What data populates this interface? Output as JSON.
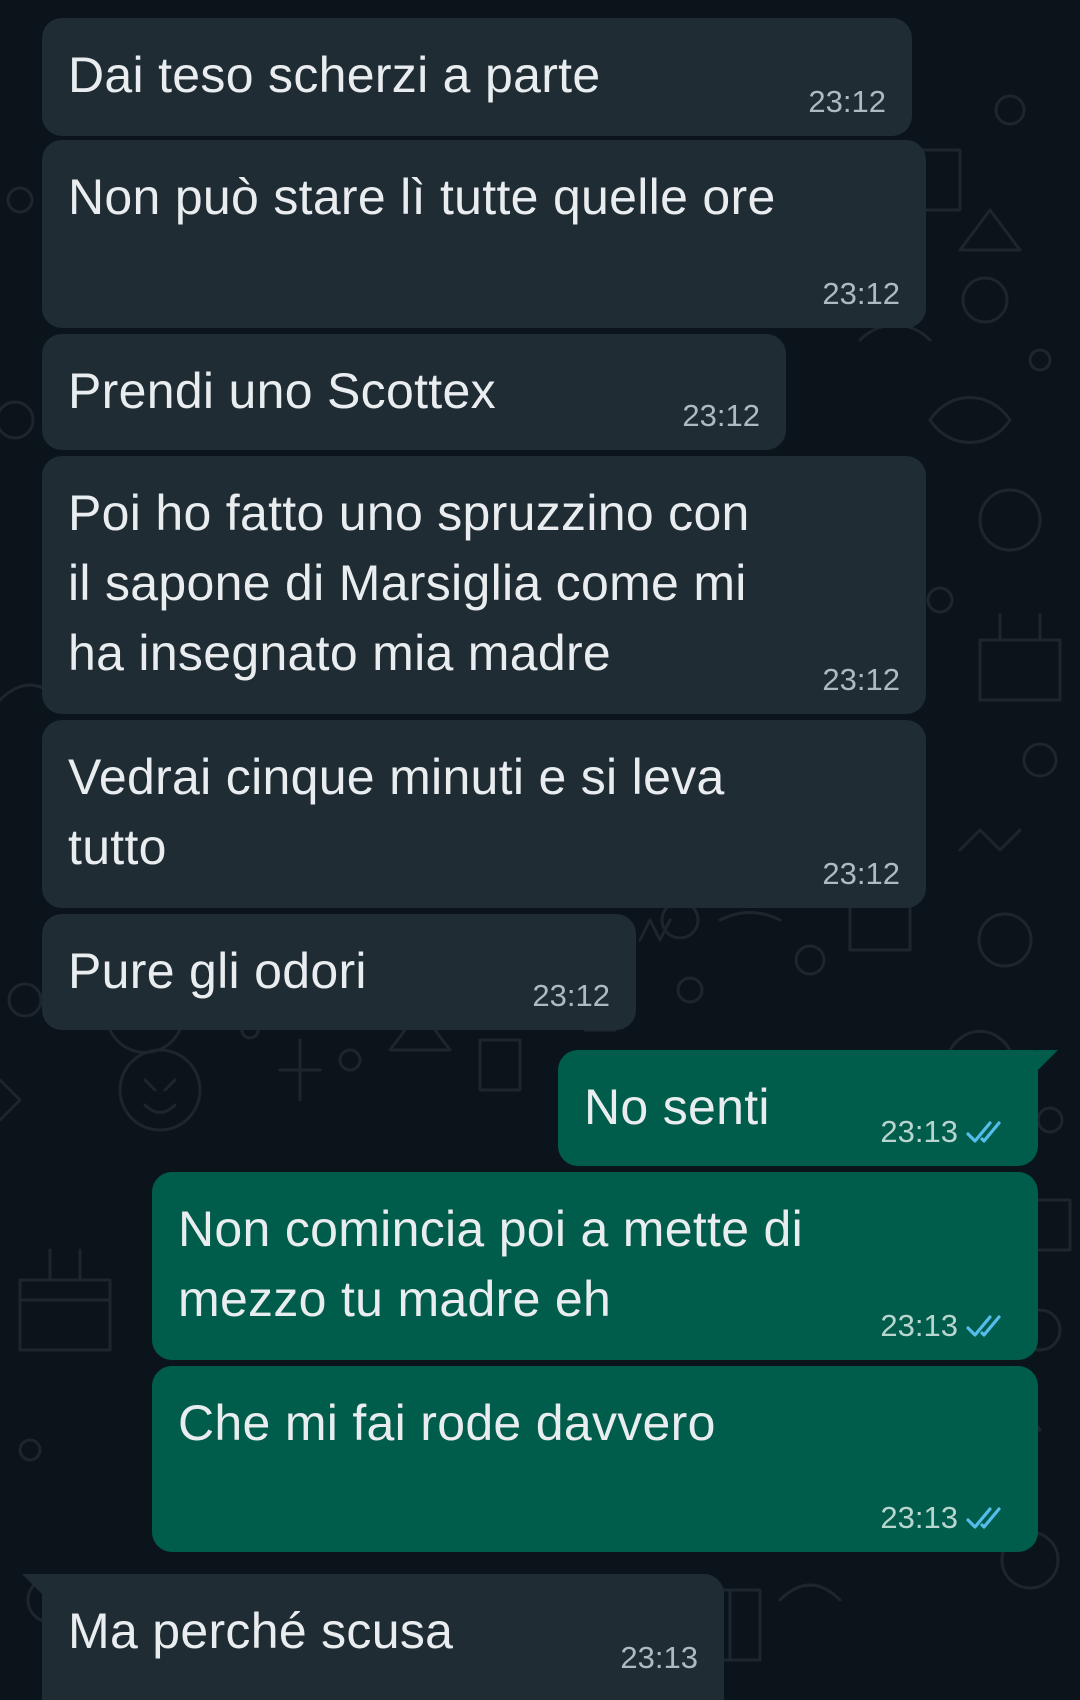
{
  "chat": {
    "messages": [
      {
        "text": "Dai teso scherzi a parte",
        "time": "23:12",
        "direction": "incoming"
      },
      {
        "text": "Non può stare lì tutte quelle ore",
        "time": "23:12",
        "direction": "incoming"
      },
      {
        "text": "Prendi uno Scottex",
        "time": "23:12",
        "direction": "incoming"
      },
      {
        "text": "Poi ho fatto uno spruzzino con\nil sapone di Marsiglia come mi\nha insegnato mia madre",
        "time": "23:12",
        "direction": "incoming"
      },
      {
        "text": "Vedrai cinque minuti e si leva\ntutto",
        "time": "23:12",
        "direction": "incoming"
      },
      {
        "text": "Pure gli odori",
        "time": "23:12",
        "direction": "incoming"
      },
      {
        "text": "No senti",
        "time": "23:13",
        "direction": "outgoing",
        "status": "read"
      },
      {
        "text": "Non comincia poi a mette di\nmezzo tu madre eh",
        "time": "23:13",
        "direction": "outgoing",
        "status": "read"
      },
      {
        "text": "Che mi fai rode davvero",
        "time": "23:13",
        "direction": "outgoing",
        "status": "read"
      },
      {
        "text": "Ma perché scusa",
        "time": "23:13",
        "direction": "incoming"
      }
    ]
  },
  "colors": {
    "background": "#0b141a",
    "incoming_bubble": "#202c33",
    "outgoing_bubble": "#005c4b",
    "read_ticks": "#53bdeb"
  },
  "icons": {
    "read_receipt": "double-check-icon",
    "wallpaper": "doodle-pattern"
  }
}
